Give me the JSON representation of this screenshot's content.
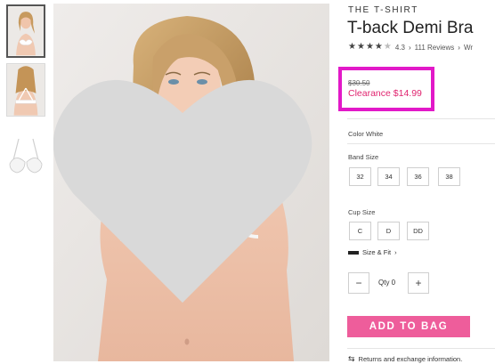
{
  "gallery": {
    "thumbnails": [
      {
        "name": "thumbnail-front-view",
        "selected": true
      },
      {
        "name": "thumbnail-back-view",
        "selected": false
      },
      {
        "name": "thumbnail-product-only",
        "selected": false
      }
    ]
  },
  "product": {
    "eyebrow": "THE T-SHIRT",
    "title": "T-back Demi Bra",
    "rating": {
      "stars_filled": 4,
      "stars_half": true,
      "value": "4.3",
      "separator": "›",
      "reviews": "111 Reviews",
      "truncated_link": "Wr"
    },
    "price": {
      "was": "$30.50",
      "sale": "Clearance $14.99"
    },
    "color": {
      "label": "Color White"
    },
    "band_size": {
      "label": "Band Size",
      "options": [
        "32",
        "34",
        "36",
        "38"
      ]
    },
    "cup_size": {
      "label": "Cup Size",
      "options": [
        "C",
        "D",
        "DD"
      ]
    },
    "size_fit": {
      "label": "Size & Fit",
      "chevron": "›"
    },
    "quantity": {
      "label": "Qty 0",
      "minus": "−",
      "plus": "+"
    },
    "add_to_bag": "ADD TO BAG",
    "returns": {
      "icon": "⇆",
      "text": "Returns and exchange information."
    }
  },
  "colors": {
    "highlight_box": "#e219c8",
    "sale_price": "#e0246f",
    "add_button": "#ee5d9b"
  }
}
